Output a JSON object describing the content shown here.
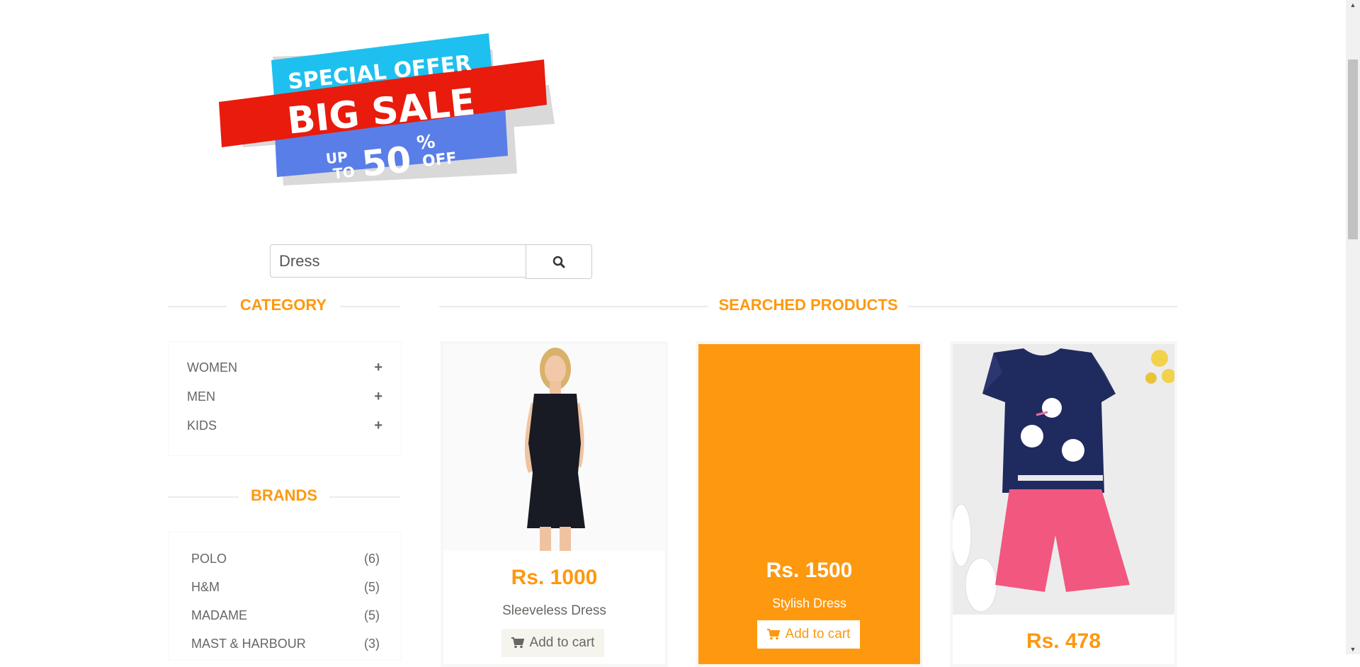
{
  "banner": {
    "line1": "SPECIAL OFFER",
    "line2": "BIG SALE",
    "up": "UP",
    "to": "TO",
    "percent": "50",
    "percent_sign": "%",
    "off": "OFF"
  },
  "search": {
    "value": "Dress",
    "icon": "search-icon"
  },
  "sidebar": {
    "category_title": "CATEGORY",
    "categories": [
      {
        "label": "WOMEN",
        "icon": "plus-icon"
      },
      {
        "label": "MEN",
        "icon": "plus-icon"
      },
      {
        "label": "KIDS",
        "icon": "plus-icon"
      }
    ],
    "brands_title": "BRANDS",
    "brands": [
      {
        "label": "POLO",
        "count": "(6)"
      },
      {
        "label": "H&M",
        "count": "(5)"
      },
      {
        "label": "MADAME",
        "count": "(5)"
      },
      {
        "label": "MAST & HARBOUR",
        "count": "(3)"
      }
    ]
  },
  "main": {
    "title": "SEARCHED PRODUCTS",
    "products": [
      {
        "price": "Rs. 1000",
        "name": "Sleeveless Dress",
        "cart_label": "Add to cart"
      },
      {
        "price": "Rs. 1500",
        "name": "Stylish Dress",
        "cart_label": "Add to cart"
      },
      {
        "price": "Rs. 478"
      }
    ]
  },
  "colors": {
    "accent": "#fe980f",
    "cart_bg": "#f5f5ed",
    "text": "#696763"
  }
}
